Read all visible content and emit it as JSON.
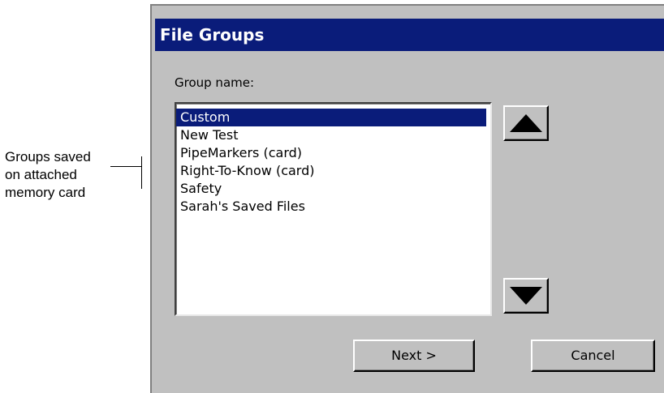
{
  "callout": {
    "lines": [
      "Groups saved",
      "on attached",
      "memory card"
    ]
  },
  "dialog": {
    "title": "File Groups",
    "group_label": "Group name:",
    "list_items": [
      "Custom",
      "New Test",
      "PipeMarkers (card)",
      "Right-To-Know (card)",
      "Safety",
      "Sarah's Saved Files"
    ],
    "selected_item": "Custom",
    "buttons": {
      "next_label": "Next >",
      "cancel_label": "Cancel"
    },
    "icons": {
      "scroll_up": "up-arrow-icon",
      "scroll_down": "down-arrow-icon"
    },
    "colors": {
      "title_bar": "#0a1c7a",
      "selection": "#0a1c7a",
      "dialog_face": "#c0c0c0"
    }
  }
}
